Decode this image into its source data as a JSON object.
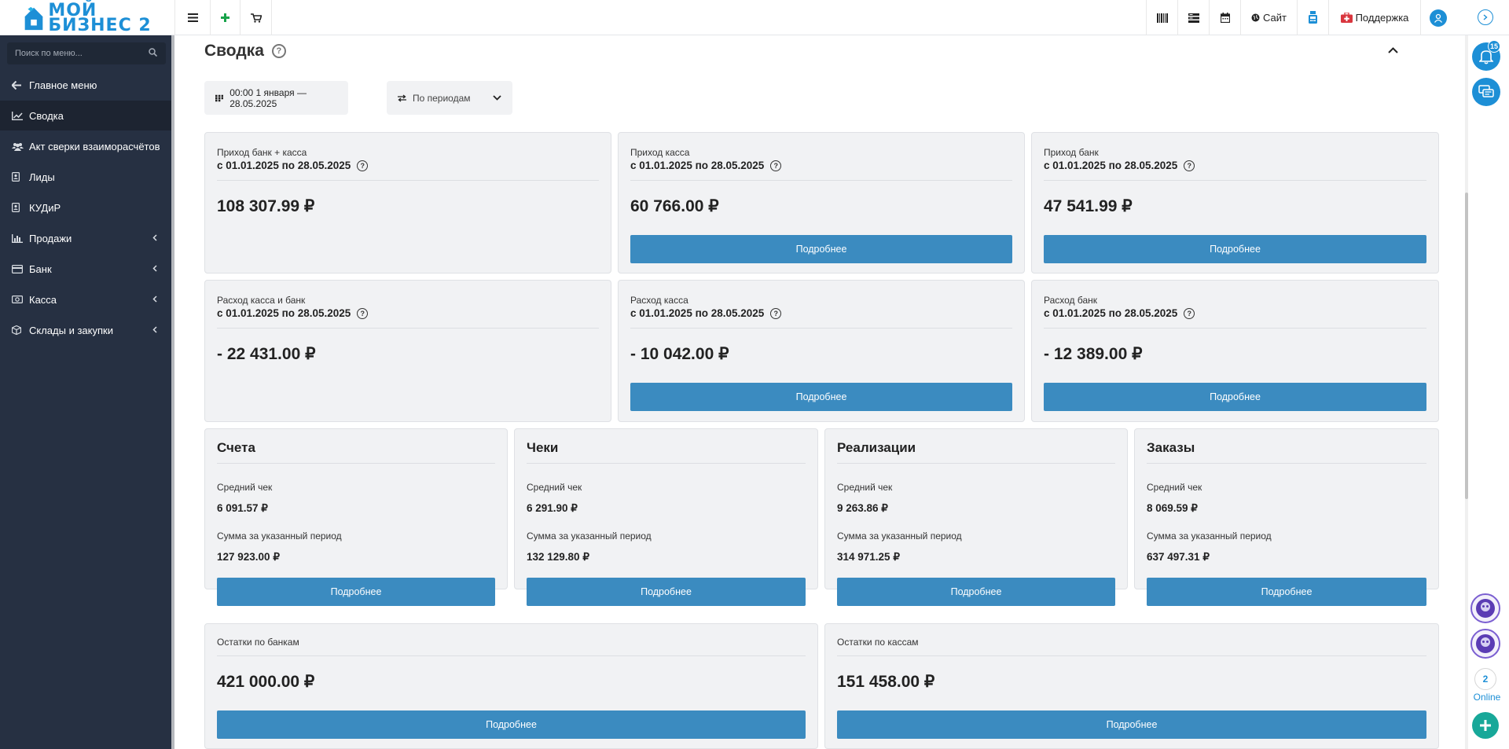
{
  "app": {
    "logo_line1": "МОЙ",
    "logo_line2": "БИЗНЕС 2"
  },
  "topbar": {
    "site_label": "Сайт",
    "support_label": "Поддержка"
  },
  "sidebar": {
    "search_placeholder": "Поиск по меню...",
    "items": [
      {
        "label": "Главное меню",
        "icon": "arrow-left-icon"
      },
      {
        "label": "Сводка",
        "icon": "chart-line-icon",
        "active": true
      },
      {
        "label": "Акт сверки взаиморасчётов",
        "icon": "users-icon"
      },
      {
        "label": "Лиды",
        "icon": "contact-card-icon"
      },
      {
        "label": "КУДиР",
        "icon": "book-icon"
      },
      {
        "label": "Продажи",
        "icon": "bar-chart-icon",
        "has_children": true
      },
      {
        "label": "Банк",
        "icon": "credit-card-icon",
        "has_children": true
      },
      {
        "label": "Касса",
        "icon": "money-icon",
        "has_children": true
      },
      {
        "label": "Склады и закупки",
        "icon": "box-icon",
        "has_children": true
      }
    ]
  },
  "main": {
    "title": "Сводка",
    "date_filter": "00:00 1 января — 28.05.2025",
    "period_filter": "По периодам",
    "more_label": "Подробнее",
    "income_cards": [
      {
        "label": "Приход банк + касса",
        "period": "с 01.01.2025 по 28.05.2025",
        "amount": "108 307.99 ₽",
        "has_button": false
      },
      {
        "label": "Приход касса",
        "period": "с 01.01.2025 по 28.05.2025",
        "amount": "60 766.00 ₽",
        "has_button": true
      },
      {
        "label": "Приход банк",
        "period": "с 01.01.2025 по 28.05.2025",
        "amount": "47 541.99 ₽",
        "has_button": true
      }
    ],
    "expense_cards": [
      {
        "label": "Расход касса и банк",
        "period": "с 01.01.2025 по 28.05.2025",
        "amount": "- 22 431.00 ₽",
        "has_button": false
      },
      {
        "label": "Расход касса",
        "period": "с 01.01.2025 по 28.05.2025",
        "amount": "- 10 042.00 ₽",
        "has_button": true
      },
      {
        "label": "Расход банк",
        "period": "с 01.01.2025 по 28.05.2025",
        "amount": "- 12 389.00 ₽",
        "has_button": true
      }
    ],
    "doc_cards": [
      {
        "title": "Счета",
        "avg_label": "Средний чек",
        "avg": "6 091.57 ₽",
        "sum_label": "Сумма за указанный период",
        "sum": "127 923.00 ₽"
      },
      {
        "title": "Чеки",
        "avg_label": "Средний чек",
        "avg": "6 291.90 ₽",
        "sum_label": "Сумма за указанный период",
        "sum": "132 129.80 ₽"
      },
      {
        "title": "Реализации",
        "avg_label": "Средний чек",
        "avg": "9 263.86 ₽",
        "sum_label": "Сумма за указанный период",
        "sum": "314 971.25 ₽"
      },
      {
        "title": "Заказы",
        "avg_label": "Средний чек",
        "avg": "8 069.59 ₽",
        "sum_label": "Сумма за указанный период",
        "sum": "637 497.31 ₽"
      }
    ],
    "balance_cards": [
      {
        "label": "Остатки по банкам",
        "amount": "421 000.00 ₽"
      },
      {
        "label": "Остатки по кассам",
        "amount": "151 458.00 ₽"
      }
    ]
  },
  "rail": {
    "notifications_count": "15",
    "online_count": "2",
    "online_label": "Online"
  },
  "colors": {
    "sidebar_bg": "#263042",
    "button_blue": "#3b8bc0",
    "card_bg": "#f1f2f4",
    "support_red": "#d9363e",
    "rail_blue": "#1d8fd6",
    "add_teal": "#18a899"
  }
}
